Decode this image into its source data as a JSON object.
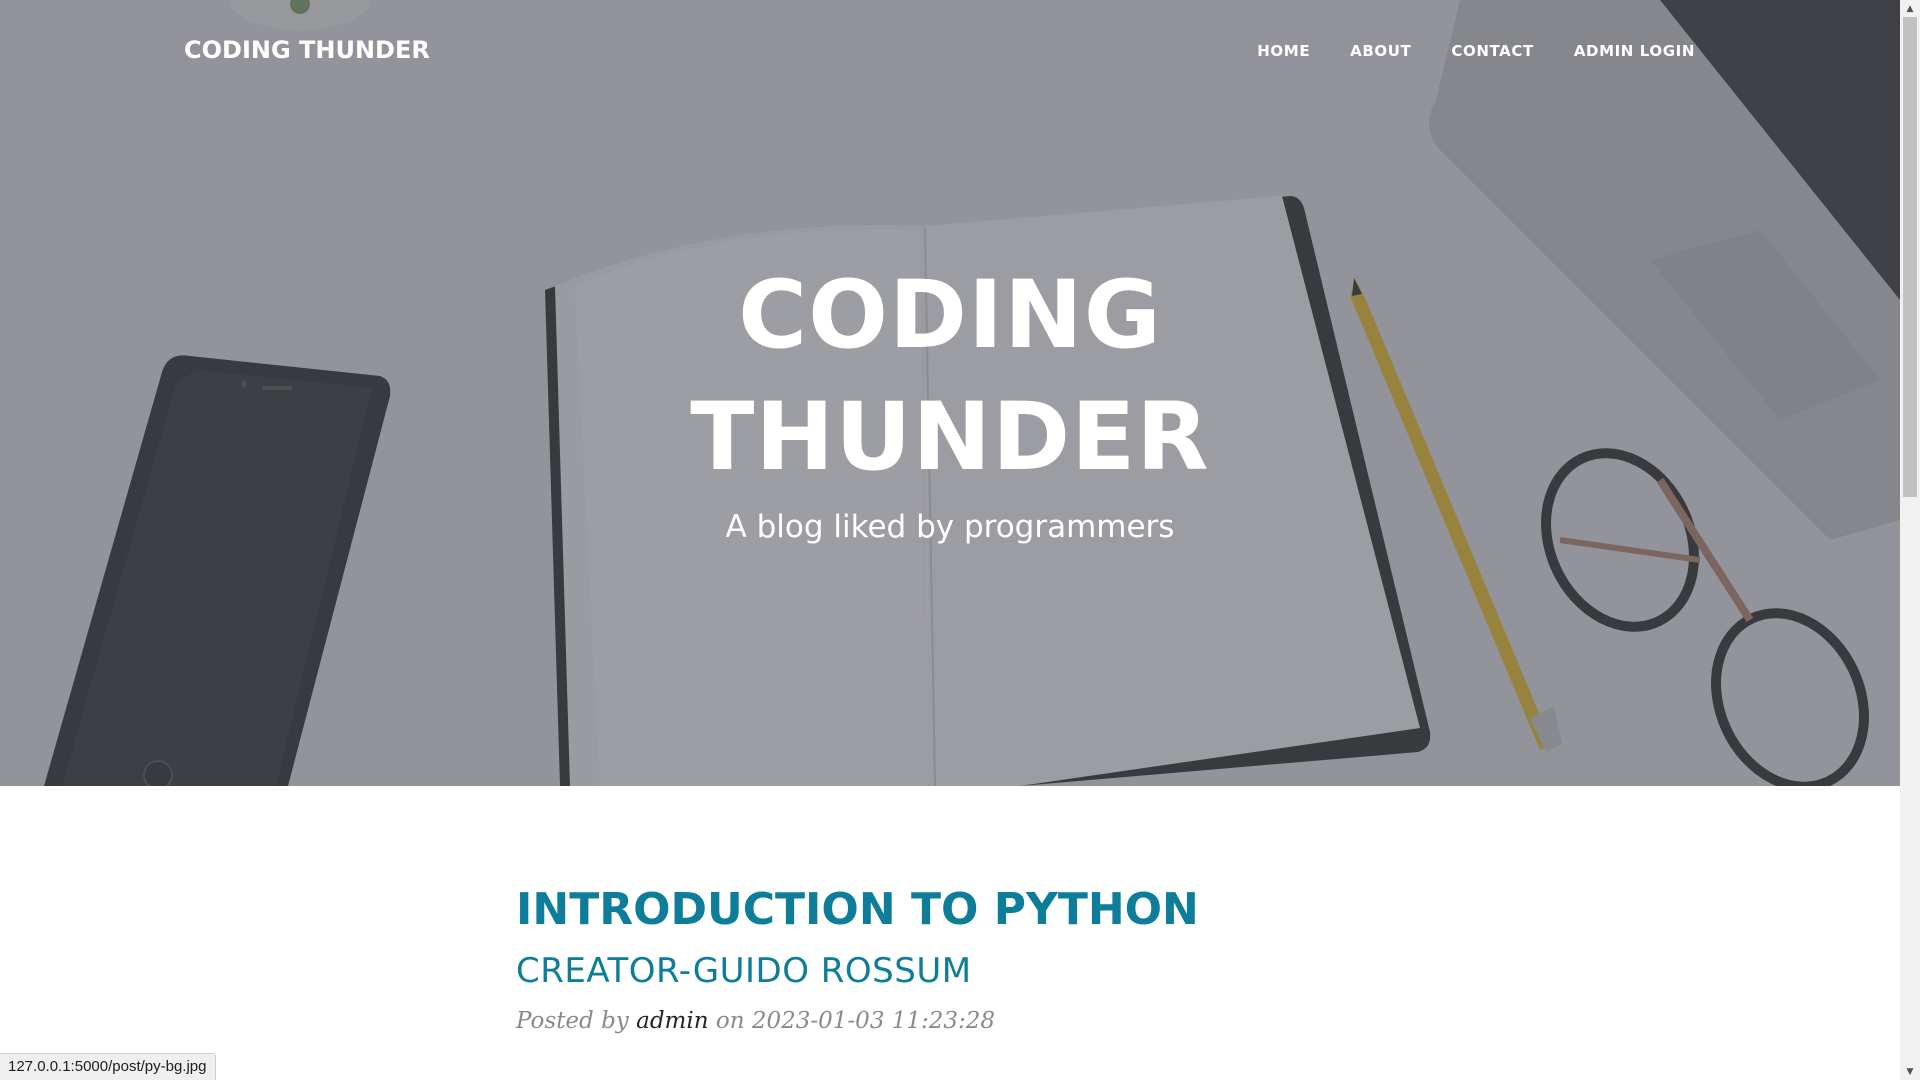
{
  "navbar": {
    "brand": "CODING THUNDER",
    "links": [
      {
        "label": "HOME"
      },
      {
        "label": "ABOUT"
      },
      {
        "label": "CONTACT"
      },
      {
        "label": "ADMIN LOGIN"
      }
    ]
  },
  "hero": {
    "title": "CODING THUNDER",
    "subtitle": "A blog liked by programmers",
    "background_image": "desk-with-notebook-phone-pencil-glasses-laptop",
    "overlay_color": "#464850"
  },
  "posts": [
    {
      "title": "INTRODUCTION TO PYTHON",
      "subtitle": "CREATOR-GUIDO ROSSUM",
      "meta_prefix": "Posted by",
      "author": "admin",
      "meta_on": "on",
      "date": "2023-01-03 11:23:28"
    }
  ],
  "status_bar": {
    "url": "127.0.0.1:5000/post/py-bg.jpg"
  },
  "colors": {
    "post_title": "#0e7d9a",
    "meta_text": "#8a8a8a"
  },
  "scrollbar": {
    "up_icon": "scroll-up-arrow",
    "down_icon": "scroll-down-arrow"
  }
}
